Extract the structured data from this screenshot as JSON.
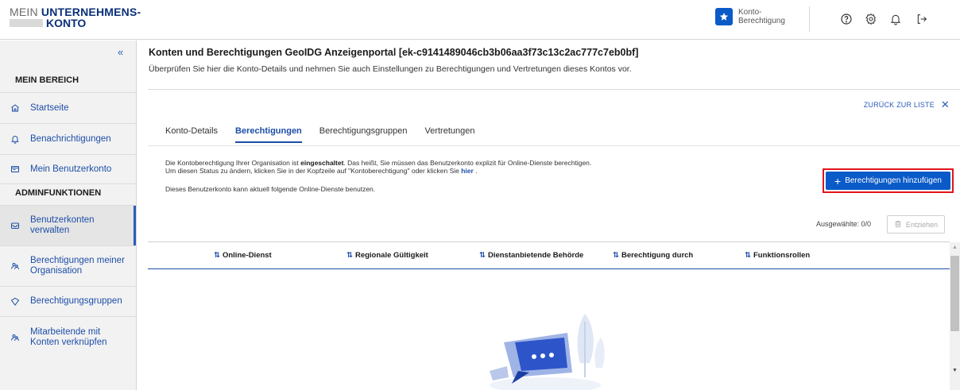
{
  "header": {
    "logo_line1_prefix": "MEIN ",
    "logo_line1_bold": "UNTERNEHMENS-",
    "logo_line2_bold": "KONTO",
    "konto_badge_line1": "Konto-",
    "konto_badge_line2": "Berechtigung",
    "icons": [
      "star-icon",
      "help-icon",
      "settings-icon",
      "bell-icon",
      "logout-icon"
    ]
  },
  "sidebar": {
    "collapse_label": "«",
    "section_mein": "MEIN BEREICH",
    "section_admin": "ADMINFUNKTIONEN",
    "items": [
      {
        "label": "Startseite",
        "icon": "home-icon"
      },
      {
        "label": "Benachrichtigungen",
        "icon": "bell-icon"
      },
      {
        "label": "Mein Benutzerkonto",
        "icon": "id-card-icon"
      },
      {
        "label1": "Benutzerkonten",
        "label2": "verwalten",
        "icon": "users-box-icon",
        "active": true
      },
      {
        "label1": "Berechtigungen meiner",
        "label2": "Organisation",
        "icon": "group-icon"
      },
      {
        "label": "Berechtigungsgruppen",
        "icon": "tag-icon"
      },
      {
        "label1": "Mitarbeitende mit",
        "label2": "Konten verknüpfen",
        "icon": "link-users-icon"
      }
    ]
  },
  "main": {
    "title": "Konten und Berechtigungen GeoIDG Anzeigenportal [ek-c9141489046cb3b06aa3f73c13c2ac777c7eb0bf]",
    "subtitle": "Überprüfen Sie hier die Konto-Details und nehmen Sie auch Einstellungen zu Berechtigungen und Vertretungen dieses Kontos vor.",
    "back_label": "ZURÜCK ZUR LISTE",
    "back_close": "✕",
    "tabs": [
      "Konto-Details",
      "Berechtigungen",
      "Berechtigungsgruppen",
      "Vertretungen"
    ],
    "active_tab": "Berechtigungen",
    "info1_a": "Die Kontoberechtigung Ihrer Organisation ist ",
    "info1_b": "eingeschaltet",
    "info1_c": ". Das heißt, Sie müssen das Benutzerkonto explizit für Online-Dienste berechtigen.",
    "info2_a": "Um diesen Status zu ändern, klicken Sie in der Kopfzeile auf \"Kontoberechtigung\" oder klicken Sie ",
    "info2_link": "hier",
    "info2_c": " .",
    "info3": "Dieses Benutzerkonto kann aktuell folgende Online-Dienste benutzen.",
    "add_button": "Berechtigungen hinzufügen",
    "selected_label": "Ausgewählte: 0/0",
    "withdraw_button": "Entziehen",
    "columns": [
      "Online-Dienst",
      "Regionale Gültigkeit",
      "Dienstanbietende Behörde",
      "Berechtigung durch",
      "Funktionsrollen"
    ]
  },
  "colors": {
    "primary": "#0a5ac8",
    "link": "#1d4ea8",
    "highlight_border": "#e0151b"
  }
}
